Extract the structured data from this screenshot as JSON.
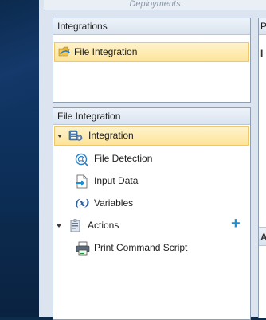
{
  "window": {
    "header_text": "Deployments"
  },
  "integrations_panel": {
    "title": "Integrations",
    "items": [
      {
        "label": "File Integration",
        "icon": "folder-link-icon",
        "selected": true
      }
    ]
  },
  "file_integration_panel": {
    "title": "File Integration",
    "tree": {
      "root_label": "Integration",
      "children": [
        {
          "label": "File Detection",
          "icon": "file-detection-icon"
        },
        {
          "label": "Input Data",
          "icon": "input-data-icon"
        },
        {
          "label": "Variables",
          "icon": "variables-icon",
          "glyph": "(x)"
        }
      ],
      "actions_label": "Actions",
      "add_glyph": "+",
      "action_children": [
        {
          "label": "Print Command Script",
          "icon": "print-icon"
        }
      ]
    }
  },
  "right_panel": {
    "header_text": "P",
    "letter_1": "I",
    "letter_2": "A"
  },
  "colors": {
    "selection_fill": "#fde49a",
    "add_accent": "#1a8fd6"
  }
}
